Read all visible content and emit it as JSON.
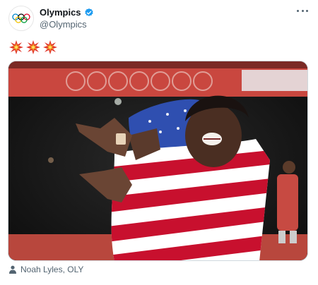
{
  "author": {
    "name": "Olympics",
    "handle": "@Olympics",
    "verified_color": "#1d9bf0"
  },
  "tweet": {
    "emojis": [
      "collision-icon",
      "collision-icon",
      "collision-icon"
    ]
  },
  "media": {
    "tagged_person": "Noah Lyles, OLY"
  },
  "colors": {
    "track_red": "#c9473f",
    "flag_red": "#c8102e",
    "flag_blue": "#2f4fb0"
  }
}
